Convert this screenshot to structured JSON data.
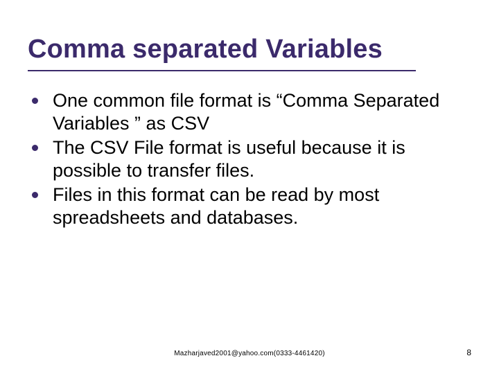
{
  "title": "Comma separated Variables",
  "bullets": [
    "One common file format is “Comma Separated Variables ” as CSV",
    "The CSV File format is useful because it is possible to transfer files.",
    "Files in this format can be read by most spreadsheets and databases."
  ],
  "footer": "Mazharjaved2001@yahoo.com(0333-4461420)",
  "pageNumber": "8"
}
